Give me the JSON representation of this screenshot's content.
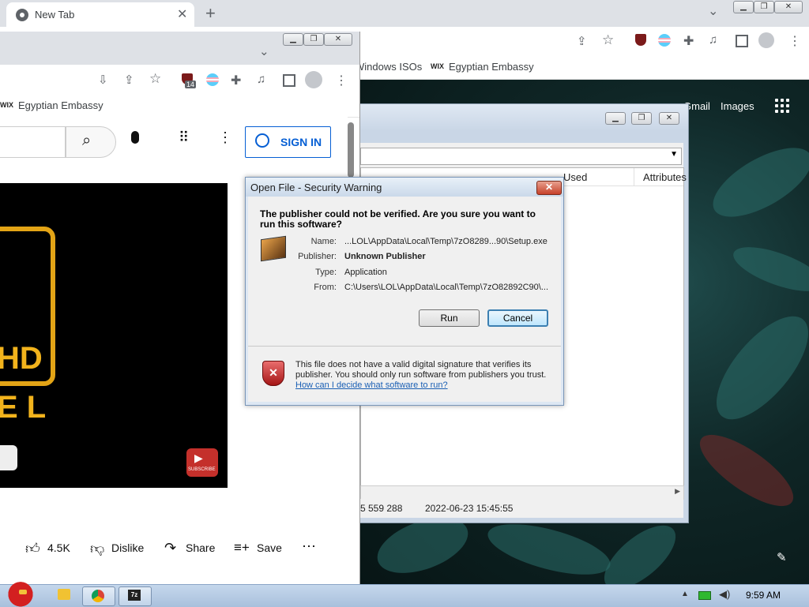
{
  "back_chrome": {
    "tab_title": "New Tab",
    "bookmarks": [
      "Windows ISOs",
      "Egyptian Embassy"
    ],
    "google_links": [
      "Gmail",
      "Images"
    ]
  },
  "zip_window": {
    "columns": [
      "Used",
      "Attributes"
    ],
    "status_size": "5 559 288",
    "status_date": "2022-06-23 15:45:55"
  },
  "front_chrome": {
    "bookmark": "Egyptian Embassy",
    "extension_badge": "14",
    "sign_in_label": "SIGN IN",
    "video_logo_text": [
      "HD",
      "E L"
    ],
    "subscribe_label": "SUBSCRIBE",
    "actions": {
      "like_count": "4.5K",
      "dislike": "Dislike",
      "share": "Share",
      "save": "Save"
    }
  },
  "dialog": {
    "title": "Open File - Security Warning",
    "question": "The publisher could not be verified.  Are you sure you want to run this software?",
    "fields": [
      {
        "label": "Name:",
        "value": "...LOL\\AppData\\Local\\Temp\\7zO8289...90\\Setup.exe"
      },
      {
        "label": "Publisher:",
        "value": "Unknown Publisher"
      },
      {
        "label": "Type:",
        "value": "Application"
      },
      {
        "label": "From:",
        "value": "C:\\Users\\LOL\\AppData\\Local\\Temp\\7zO82892C90\\..."
      }
    ],
    "run_label": "Run",
    "cancel_label": "Cancel",
    "warning_text": "This file does not have a valid digital signature that verifies its publisher.  You should only run software from publishers you trust.",
    "help_link": "How can I decide what software to run?"
  },
  "taskbar": {
    "clock": "9:59 AM"
  }
}
